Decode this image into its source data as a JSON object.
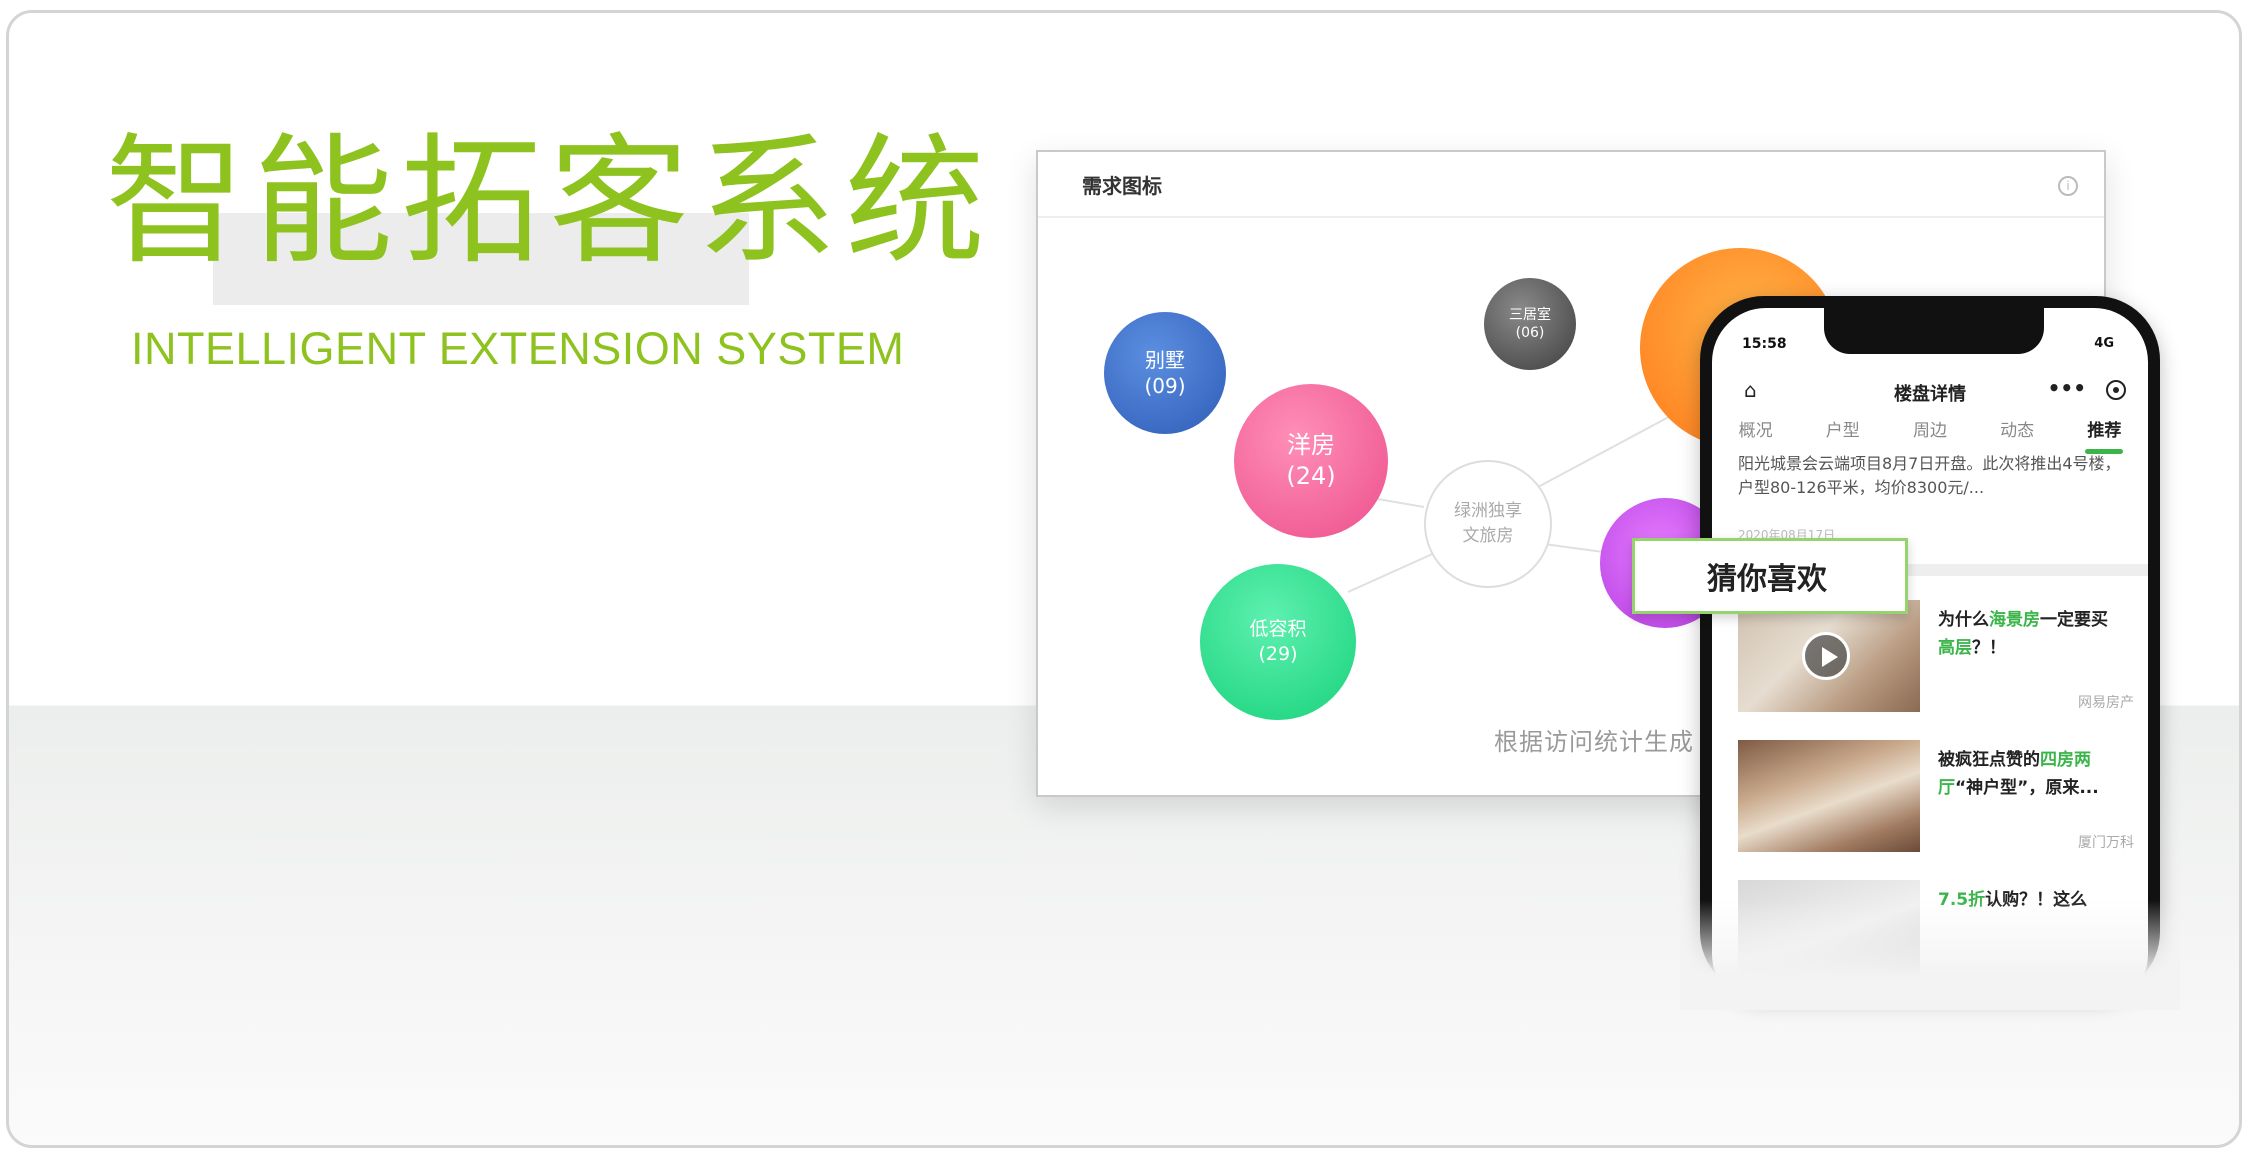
{
  "hero": {
    "title": "智能拓客系统",
    "subtitle": "INTELLIGENT EXTENSION SYSTEM",
    "accent_color": "#8dc21f"
  },
  "panel": {
    "title": "需求图标",
    "info_icon": "info-icon",
    "center_node": [
      "绿洲独享",
      "文旅房"
    ],
    "bubbles": [
      {
        "label": "别墅",
        "count": "(09)",
        "color": "#3a6bc4"
      },
      {
        "label": "洋房",
        "count": "(24)",
        "color": "#f2649a"
      },
      {
        "label": "低容积",
        "count": "(29)",
        "color": "#2bd98a"
      },
      {
        "label": "三居室",
        "count": "(06)",
        "color": "#555555"
      }
    ],
    "caption": "根据访问统计生成"
  },
  "phone": {
    "status_time": "15:58",
    "status_right": "4G",
    "nav_title": "楼盘详情",
    "tabs": [
      "概况",
      "户型",
      "周边",
      "动态",
      "推荐"
    ],
    "active_tab": "推荐",
    "news_text": "阳光城景会云端项目8月7日开盘。此次将推出4号楼，户型80-126平米，均价8300元/...",
    "news_date": "2020年08月17日",
    "feed": [
      {
        "title_pre": "为什么",
        "title_hl": "海景房",
        "title_mid": "一定要买",
        "title_hl2": "高层",
        "title_post": "？！",
        "source": "网易房产"
      },
      {
        "title_pre": "被疯狂点赞的",
        "title_hl": "四房两厅",
        "title_mid": "“神户型”，原来...",
        "title_hl2": "",
        "title_post": "",
        "source": "厦门万科"
      },
      {
        "title_pre": "",
        "title_hl": "7.5折",
        "title_mid": "认购？！这么",
        "title_hl2": "",
        "title_post": "",
        "source": ""
      }
    ]
  },
  "guess_label": "猜你喜欢"
}
